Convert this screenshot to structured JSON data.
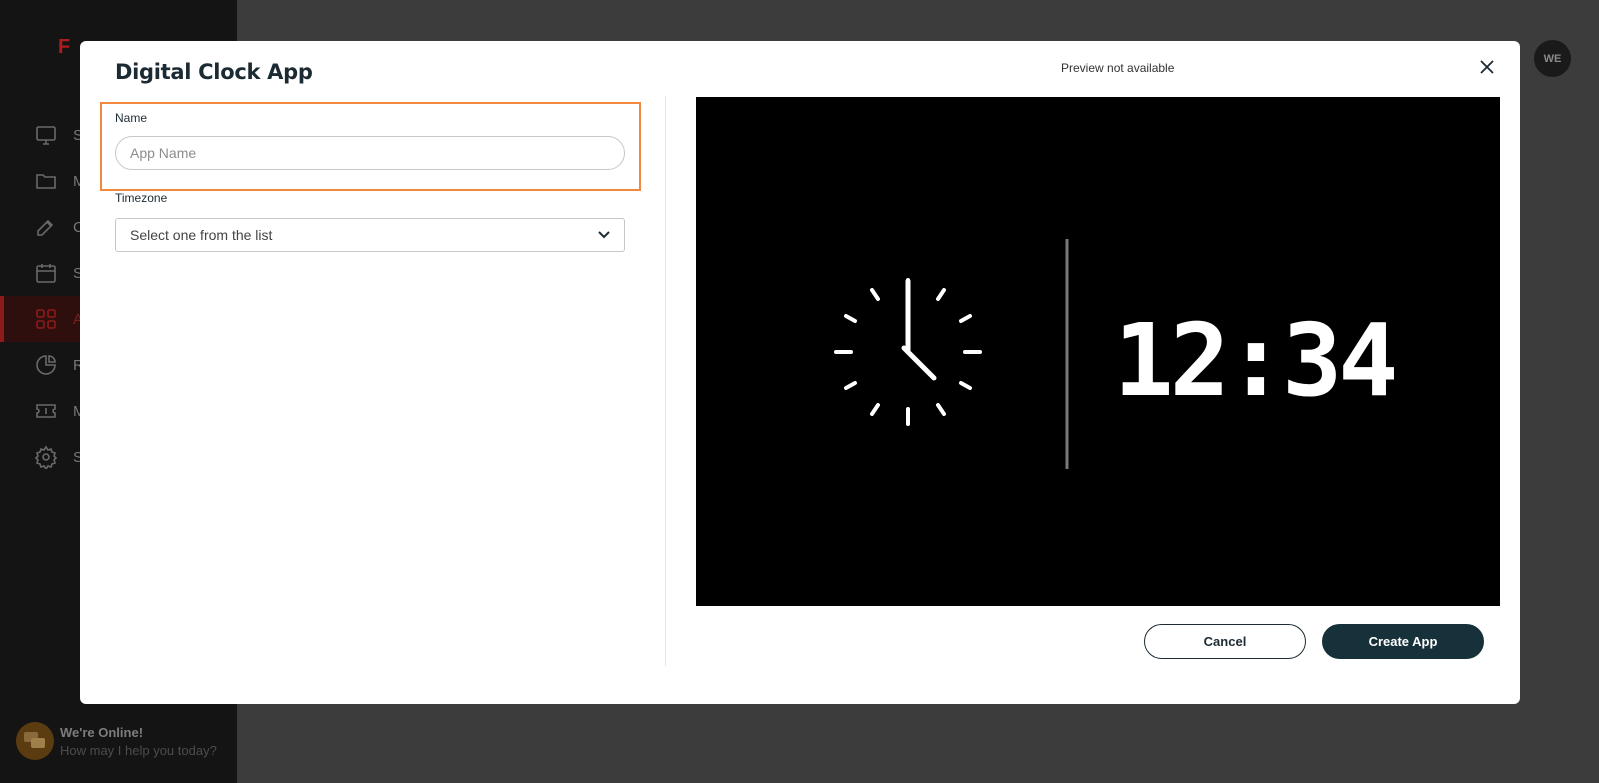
{
  "background": {
    "avatar_initials": "WE",
    "chat": {
      "title": "We're Online!",
      "subtitle": "How may I help you today?"
    },
    "nav_letters": [
      "S",
      "M",
      "C",
      "S",
      "A",
      "R",
      "M",
      "S"
    ]
  },
  "modal": {
    "title": "Digital Clock App",
    "preview_note": "Preview not available",
    "name_field": {
      "label": "Name",
      "value": "",
      "placeholder": "App Name"
    },
    "timezone_field": {
      "label": "Timezone",
      "selected": "Select one from the list"
    },
    "preview": {
      "digital_time": "12:34"
    },
    "buttons": {
      "cancel": "Cancel",
      "create": "Create App"
    }
  },
  "colors": {
    "primary": "#17313a",
    "highlight": "#f0883e",
    "accent_red": "#b11b1b"
  }
}
